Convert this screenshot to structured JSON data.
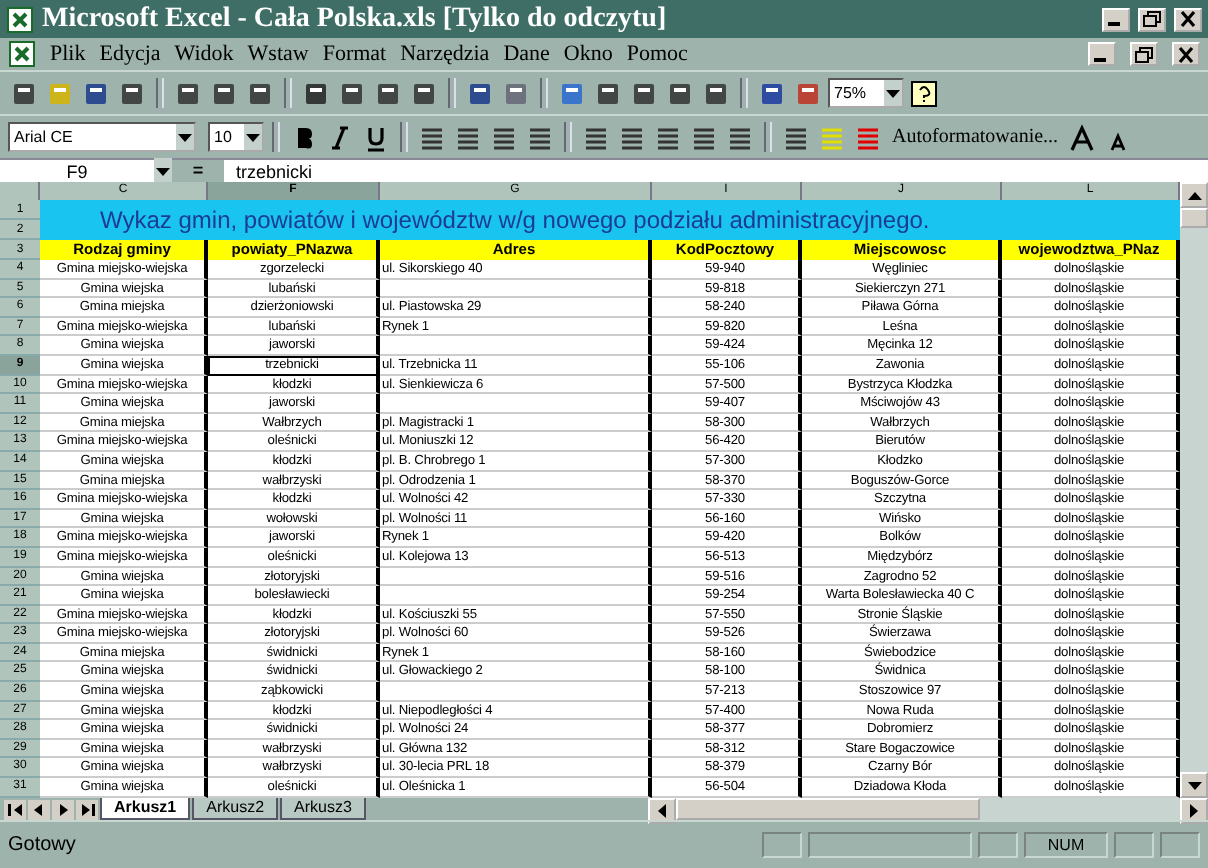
{
  "window": {
    "title": "Microsoft Excel - Cała Polska.xls  [Tylko do odczytu]"
  },
  "menu": [
    "Plik",
    "Edycja",
    "Widok",
    "Wstaw",
    "Format",
    "Narzędzia",
    "Dane",
    "Okno",
    "Pomoc"
  ],
  "toolbar": {
    "zoom": "75%"
  },
  "format_toolbar": {
    "font": "Arial CE",
    "size": "10",
    "autoformat": "Autoformatowanie..."
  },
  "formula_bar": {
    "name_box": "F9",
    "equals": "=",
    "value": "trzebnicki"
  },
  "columns": [
    {
      "letter": "C",
      "selected": false
    },
    {
      "letter": "F",
      "selected": true
    },
    {
      "letter": "G",
      "selected": false
    },
    {
      "letter": "I",
      "selected": false
    },
    {
      "letter": "J",
      "selected": false
    },
    {
      "letter": "L",
      "selected": false
    }
  ],
  "sheet_title": {
    "rows": [
      "1",
      "2"
    ],
    "text": "Wykaz gmin, powiatów i województw w/g nowego podziału administracyjnego."
  },
  "header_row": {
    "row": "3",
    "cells": [
      "Rodzaj gminy",
      "powiaty_PNazwa",
      "Adres",
      "KodPocztowy",
      "Miejscowosc",
      "wojewodztwa_PNaz"
    ]
  },
  "rows": [
    {
      "row": "4",
      "selected": false,
      "cells": [
        "Gmina miejsko-wiejska",
        "zgorzelecki",
        "ul. Sikorskiego 40",
        "59-940",
        "Węgliniec",
        "dolnośląskie"
      ]
    },
    {
      "row": "5",
      "selected": false,
      "cells": [
        "Gmina wiejska",
        "lubański",
        "",
        "59-818",
        "Siekierczyn 271",
        "dolnośląskie"
      ]
    },
    {
      "row": "6",
      "selected": false,
      "cells": [
        "Gmina miejska",
        "dzierżoniowski",
        "ul. Piastowska 29",
        "58-240",
        "Piława Górna",
        "dolnośląskie"
      ]
    },
    {
      "row": "7",
      "selected": false,
      "cells": [
        "Gmina miejsko-wiejska",
        "lubański",
        "Rynek 1",
        "59-820",
        "Leśna",
        "dolnośląskie"
      ]
    },
    {
      "row": "8",
      "selected": false,
      "cells": [
        "Gmina wiejska",
        "jaworski",
        "",
        "59-424",
        "Męcinka 12",
        "dolnośląskie"
      ]
    },
    {
      "row": "9",
      "selected": true,
      "cells": [
        "Gmina wiejska",
        "trzebnicki",
        "ul. Trzebnicka 11",
        "55-106",
        "Zawonia",
        "dolnośląskie"
      ]
    },
    {
      "row": "10",
      "selected": false,
      "cells": [
        "Gmina miejsko-wiejska",
        "kłodzki",
        "ul. Sienkiewicza 6",
        "57-500",
        "Bystrzyca Kłodzka",
        "dolnośląskie"
      ]
    },
    {
      "row": "11",
      "selected": false,
      "cells": [
        "Gmina wiejska",
        "jaworski",
        "",
        "59-407",
        "Mściwojów 43",
        "dolnośląskie"
      ]
    },
    {
      "row": "12",
      "selected": false,
      "cells": [
        "Gmina miejska",
        "Wałbrzych",
        "pl. Magistracki 1",
        "58-300",
        "Wałbrzych",
        "dolnośląskie"
      ]
    },
    {
      "row": "13",
      "selected": false,
      "cells": [
        "Gmina miejsko-wiejska",
        "oleśnicki",
        "ul. Moniuszki 12",
        "56-420",
        "Bierutów",
        "dolnośląskie"
      ]
    },
    {
      "row": "14",
      "selected": false,
      "cells": [
        "Gmina wiejska",
        "kłodzki",
        "pl. B. Chrobrego 1",
        "57-300",
        "Kłodzko",
        "dolnośląskie"
      ]
    },
    {
      "row": "15",
      "selected": false,
      "cells": [
        "Gmina miejska",
        "wałbrzyski",
        "pl. Odrodzenia 1",
        "58-370",
        "Boguszów-Gorce",
        "dolnośląskie"
      ]
    },
    {
      "row": "16",
      "selected": false,
      "cells": [
        "Gmina miejsko-wiejska",
        "kłodzki",
        "ul. Wolności 42",
        "57-330",
        "Szczytna",
        "dolnośląskie"
      ]
    },
    {
      "row": "17",
      "selected": false,
      "cells": [
        "Gmina wiejska",
        "wołowski",
        "pl. Wolności 11",
        "56-160",
        "Wińsko",
        "dolnośląskie"
      ]
    },
    {
      "row": "18",
      "selected": false,
      "cells": [
        "Gmina miejsko-wiejska",
        "jaworski",
        "Rynek 1",
        "59-420",
        "Bolków",
        "dolnośląskie"
      ]
    },
    {
      "row": "19",
      "selected": false,
      "cells": [
        "Gmina miejsko-wiejska",
        "oleśnicki",
        "ul. Kolejowa 13",
        "56-513",
        "Międzybórz",
        "dolnośląskie"
      ]
    },
    {
      "row": "20",
      "selected": false,
      "cells": [
        "Gmina wiejska",
        "złotoryjski",
        "",
        "59-516",
        "Zagrodno 52",
        "dolnośląskie"
      ]
    },
    {
      "row": "21",
      "selected": false,
      "cells": [
        "Gmina wiejska",
        "bolesławiecki",
        "",
        "59-254",
        "Warta Bolesławiecka 40 C",
        "dolnośląskie"
      ]
    },
    {
      "row": "22",
      "selected": false,
      "cells": [
        "Gmina miejsko-wiejska",
        "kłodzki",
        "ul. Kościuszki 55",
        "57-550",
        "Stronie Śląskie",
        "dolnośląskie"
      ]
    },
    {
      "row": "23",
      "selected": false,
      "cells": [
        "Gmina miejsko-wiejska",
        "złotoryjski",
        "pl. Wolności 60",
        "59-526",
        "Świerzawa",
        "dolnośląskie"
      ]
    },
    {
      "row": "24",
      "selected": false,
      "cells": [
        "Gmina miejska",
        "świdnicki",
        "Rynek 1",
        "58-160",
        "Świebodzice",
        "dolnośląskie"
      ]
    },
    {
      "row": "25",
      "selected": false,
      "cells": [
        "Gmina wiejska",
        "świdnicki",
        "ul. Głowackiego 2",
        "58-100",
        "Świdnica",
        "dolnośląskie"
      ]
    },
    {
      "row": "26",
      "selected": false,
      "cells": [
        "Gmina wiejska",
        "ząbkowicki",
        "",
        "57-213",
        "Stoszowice 97",
        "dolnośląskie"
      ]
    },
    {
      "row": "27",
      "selected": false,
      "cells": [
        "Gmina wiejska",
        "kłodzki",
        "ul. Niepodległości 4",
        "57-400",
        "Nowa Ruda",
        "dolnośląskie"
      ]
    },
    {
      "row": "28",
      "selected": false,
      "cells": [
        "Gmina wiejska",
        "świdnicki",
        "pl. Wolności 24",
        "58-377",
        "Dobromierz",
        "dolnośląskie"
      ]
    },
    {
      "row": "29",
      "selected": false,
      "cells": [
        "Gmina wiejska",
        "wałbrzyski",
        "ul. Główna 132",
        "58-312",
        "Stare Bogaczowice",
        "dolnośląskie"
      ]
    },
    {
      "row": "30",
      "selected": false,
      "cells": [
        "Gmina wiejska",
        "wałbrzyski",
        "ul. 30-lecia PRL 18",
        "58-379",
        "Czarny Bór",
        "dolnośląskie"
      ]
    },
    {
      "row": "31",
      "selected": false,
      "cells": [
        "Gmina wiejska",
        "oleśnicki",
        "ul. Oleśnicka 1",
        "56-504",
        "Dziadowa Kłoda",
        "dolnośląskie"
      ]
    }
  ],
  "sheet_tabs": [
    {
      "label": "Arkusz1",
      "selected": true
    },
    {
      "label": "Arkusz2",
      "selected": false
    },
    {
      "label": "Arkusz3",
      "selected": false
    }
  ],
  "status_bar": {
    "text": "Gotowy",
    "indicator": "NUM"
  }
}
